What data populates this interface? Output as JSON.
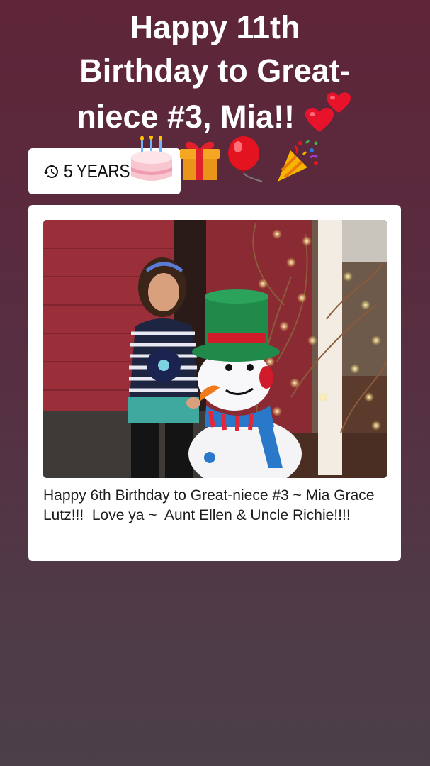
{
  "story": {
    "headline_lines": [
      "Happy 11th",
      "Birthday to Great-",
      "niece #3, Mia!!"
    ],
    "headline_emoji": "two-hearts-emoji",
    "emoji_row": [
      "birthday-cake-emoji",
      "wrapped-gift-emoji",
      "red-balloon-emoji",
      "party-popper-emoji"
    ]
  },
  "memory_badge": {
    "icon": "history-icon",
    "label": "5 YEARS AGO"
  },
  "post": {
    "photo": "photo of a girl standing beside a lit-up snowman decoration",
    "caption": "Happy 6th Birthday to Great-niece #3 ~ Mia Grace Lutz!!!  Love ya ~  Aunt Ellen & Uncle Richie!!!!"
  },
  "colors": {
    "background_top": "#5f2538",
    "background_bottom": "#4c3f48",
    "card": "#ffffff",
    "text_light": "#ffffff",
    "text_dark": "#1c1c1c"
  }
}
